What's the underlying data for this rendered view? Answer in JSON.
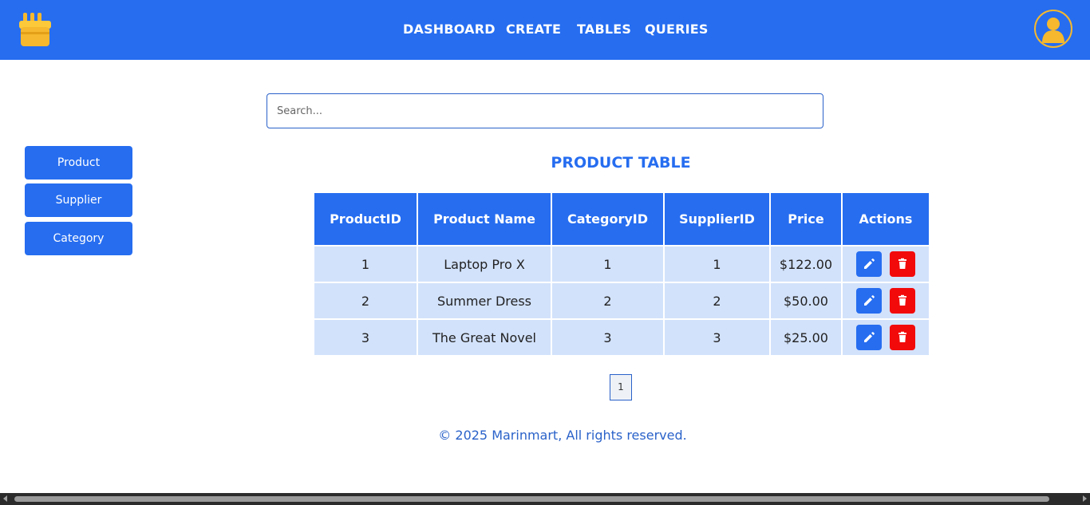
{
  "header": {
    "logo_icon": "shop-basket-icon",
    "nav": [
      {
        "label": "DASHBOARD"
      },
      {
        "label": "CREATE"
      },
      {
        "label": "TABLES"
      },
      {
        "label": "QUERIES"
      }
    ],
    "avatar_icon": "user-avatar-icon"
  },
  "search": {
    "placeholder": "Search..."
  },
  "sidebar": {
    "items": [
      {
        "label": "Product"
      },
      {
        "label": "Supplier"
      },
      {
        "label": "Category"
      }
    ]
  },
  "table": {
    "title": "PRODUCT TABLE",
    "columns": [
      "ProductID",
      "Product Name",
      "CategoryID",
      "SupplierID",
      "Price",
      "Actions"
    ],
    "rows": [
      [
        "1",
        "Laptop Pro X",
        "1",
        "1",
        "$122.00"
      ],
      [
        "2",
        "Summer Dress",
        "2",
        "2",
        "$50.00"
      ],
      [
        "3",
        "The Great Novel",
        "3",
        "3",
        "$25.00"
      ]
    ],
    "action_icons": [
      "pencil-icon",
      "trash-icon"
    ]
  },
  "pagination": {
    "current_page": "1"
  },
  "footer": {
    "text": "© 2025 Marinmart, All rights reserved."
  },
  "colors": {
    "primary": "#266df0",
    "row_bg": "#d2e2fb",
    "delete": "#f20a0a",
    "logo": "#f5b82e"
  }
}
